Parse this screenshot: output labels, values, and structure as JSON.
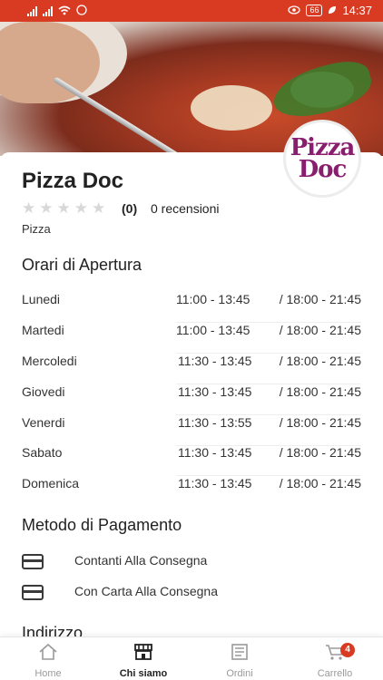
{
  "status_bar": {
    "time": "14:37",
    "battery": "66"
  },
  "restaurant": {
    "name": "Pizza Doc",
    "logo_text": "Pizza Doc",
    "rating": "(0)",
    "reviews": "0 recensioni",
    "category": "Pizza",
    "stars": 0
  },
  "hours_section": {
    "title": "Orari di Apertura",
    "rows": [
      {
        "day": "Lunedi",
        "slot1": "11:00 - 13:45",
        "slot2": "/ 18:00 - 21:45"
      },
      {
        "day": "Martedi",
        "slot1": "11:00 - 13:45",
        "slot2": "/ 18:00 - 21:45"
      },
      {
        "day": "Mercoledi",
        "slot1": "11:30 - 13:45",
        "slot2": "/ 18:00 - 21:45"
      },
      {
        "day": "Giovedi",
        "slot1": "11:30 - 13:45",
        "slot2": "/ 18:00 - 21:45"
      },
      {
        "day": "Venerdi",
        "slot1": "11:30 - 13:55",
        "slot2": "/ 18:00 - 21:45"
      },
      {
        "day": "Sabato",
        "slot1": "11:30 - 13:45",
        "slot2": "/ 18:00 - 21:45"
      },
      {
        "day": "Domenica",
        "slot1": "11:30 - 13:45",
        "slot2": "/ 18:00 - 21:45"
      }
    ]
  },
  "payment_section": {
    "title": "Metodo di Pagamento",
    "methods": [
      "Contanti Alla Consegna",
      "Con Carta Alla Consegna"
    ]
  },
  "address_section": {
    "title": "Indirizzo"
  },
  "bottom_nav": {
    "items": [
      {
        "label": "Home",
        "icon": "home-icon"
      },
      {
        "label": "Chi siamo",
        "icon": "store-icon"
      },
      {
        "label": "Ordini",
        "icon": "orders-icon"
      },
      {
        "label": "Carrello",
        "icon": "cart-icon"
      }
    ],
    "cart_badge": "4",
    "active": "Chi siamo"
  },
  "colors": {
    "brand": "#d83a22",
    "text": "#2a2a2a",
    "inactive": "#9a9a9a"
  }
}
